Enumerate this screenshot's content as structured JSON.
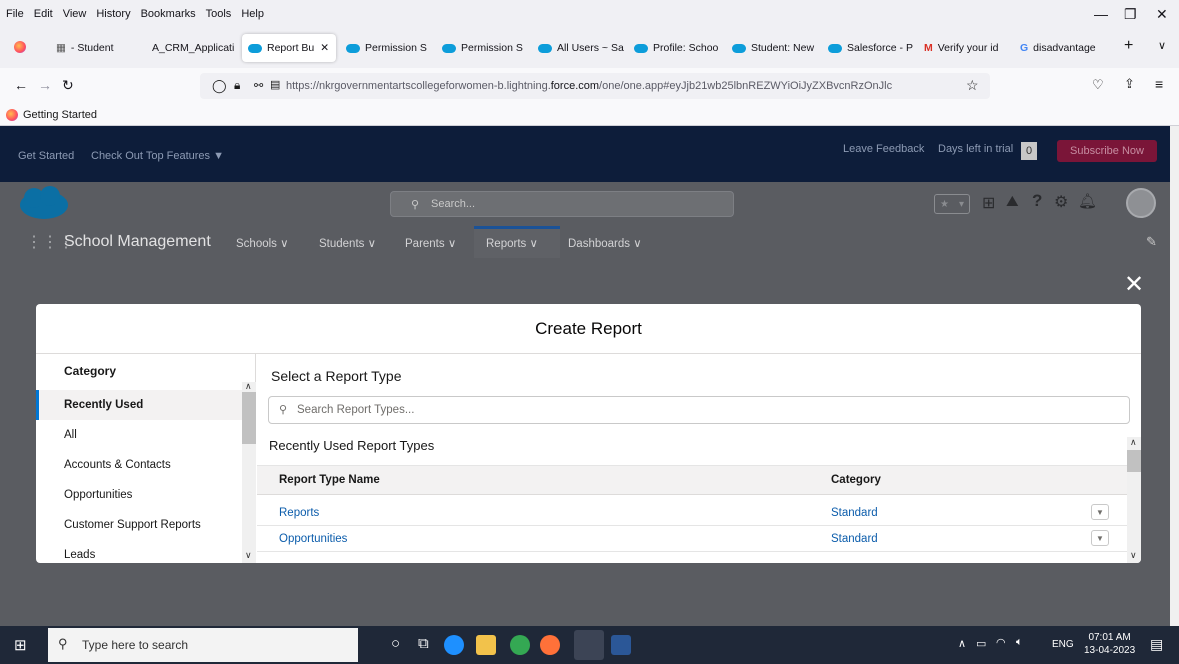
{
  "menu": [
    "File",
    "Edit",
    "View",
    "History",
    "Bookmarks",
    "Tools",
    "Help"
  ],
  "tabs": [
    {
      "label": "- Student"
    },
    {
      "label": "A_CRM_Applicati"
    },
    {
      "label": "Report Bu"
    },
    {
      "label": "Permission S"
    },
    {
      "label": "Permission S"
    },
    {
      "label": "All Users ~ Sa"
    },
    {
      "label": "Profile: Schoo"
    },
    {
      "label": "Student: New"
    },
    {
      "label": "Salesforce - P"
    },
    {
      "label": "Verify your id"
    },
    {
      "label": "disadvantage"
    }
  ],
  "address": {
    "prefix": "https://nkrgovernmentartscollegeforwomen-b.lightning.",
    "domain": "force.com",
    "suffix": "/one/one.app#eyJjb21wb25lbnREZWYiOiJyZXBvcnRzOnJlc"
  },
  "bookmarks": {
    "getting_started": "Getting Started"
  },
  "trial": {
    "get_started": "Get Started",
    "top_features": "Check Out Top Features ▼",
    "feedback": "Leave Feedback",
    "days_label": "Days left in trial",
    "days_value": "0",
    "subscribe": "Subscribe Now"
  },
  "sf": {
    "search_placeholder": "Search...",
    "app_name": "School Management",
    "nav": [
      {
        "label": "Schools ∨"
      },
      {
        "label": "Students ∨"
      },
      {
        "label": "Parents ∨"
      },
      {
        "label": "Reports ∨"
      },
      {
        "label": "Dashboards ∨"
      }
    ]
  },
  "modal": {
    "title": "Create Report",
    "category_heading": "Category",
    "categories": [
      {
        "label": "Recently Used"
      },
      {
        "label": "All"
      },
      {
        "label": "Accounts & Contacts"
      },
      {
        "label": "Opportunities"
      },
      {
        "label": "Customer Support Reports"
      },
      {
        "label": "Leads"
      }
    ],
    "select_title": "Select a Report Type",
    "search_placeholder": "Search Report Types...",
    "recent_title": "Recently Used Report Types",
    "columns": {
      "name": "Report Type Name",
      "category": "Category"
    },
    "rows": [
      {
        "name": "Reports",
        "category": "Standard"
      },
      {
        "name": "Opportunities",
        "category": "Standard"
      }
    ]
  },
  "taskbar": {
    "search_placeholder": "Type here to search",
    "lang": "ENG",
    "time": "07:01 AM",
    "date": "13-04-2023"
  },
  "colors": {
    "sf_navy": "#0d1d3a",
    "subscribe": "#7a1538",
    "link": "#0b5cab",
    "selected_border": "#0176d3"
  }
}
